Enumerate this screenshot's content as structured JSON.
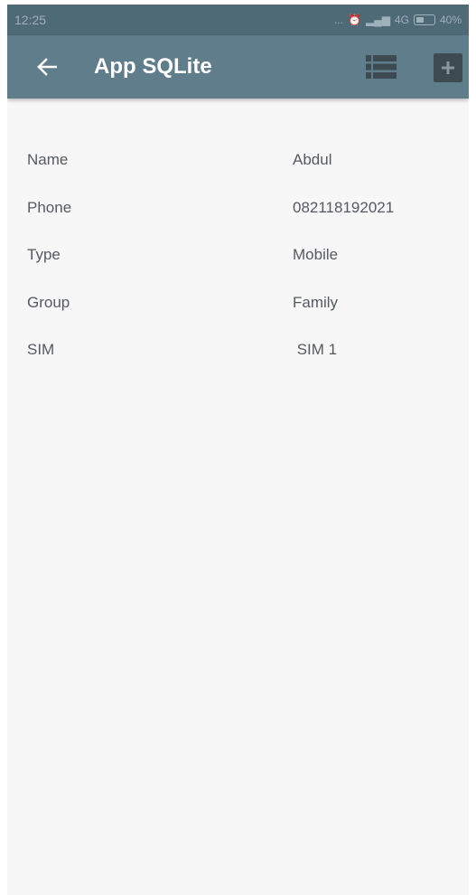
{
  "status_bar": {
    "time": "12:25",
    "indicators": "... ",
    "network": "4G",
    "battery": "40%"
  },
  "app_bar": {
    "title": "App SQLite",
    "back_icon": "arrow-left-icon",
    "list_icon": "list-icon",
    "add_icon": "plus-icon"
  },
  "details": [
    {
      "label": "Name",
      "value": "Abdul"
    },
    {
      "label": "Phone",
      "value": "082118192021"
    },
    {
      "label": "Type",
      "value": "Mobile"
    },
    {
      "label": "Group",
      "value": "Family"
    },
    {
      "label": "SIM",
      "value": " SIM 1"
    }
  ],
  "colors": {
    "status_bar": "#4e6a77",
    "app_bar": "#607d8b",
    "background": "#f7f7f7",
    "text": "#555a5e"
  }
}
